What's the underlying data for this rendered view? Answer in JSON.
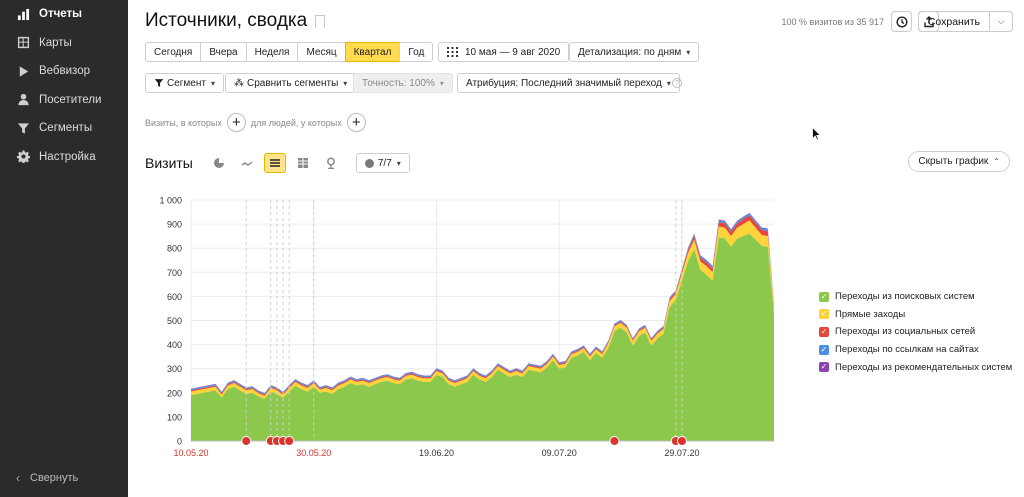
{
  "sidebar": {
    "items": [
      {
        "label": "Отчеты",
        "icon": "bar-chart-icon",
        "active": true
      },
      {
        "label": "Карты",
        "icon": "map-icon",
        "active": false
      },
      {
        "label": "Вебвизор",
        "icon": "play-icon",
        "active": false
      },
      {
        "label": "Посетители",
        "icon": "person-icon",
        "active": false
      },
      {
        "label": "Сегменты",
        "icon": "funnel-icon",
        "active": false
      },
      {
        "label": "Настройка",
        "icon": "gear-icon",
        "active": false
      }
    ],
    "collapse_label": "Свернуть"
  },
  "header": {
    "title": "Источники, сводка",
    "visits_info": "100 % визитов из 35 917",
    "save_label": "Сохранить"
  },
  "period": {
    "options": [
      "Сегодня",
      "Вчера",
      "Неделя",
      "Месяц",
      "Квартал",
      "Год"
    ],
    "selected": "Квартал",
    "date_range": "10 мая — 9 авг 2020",
    "detail": "Детализация: по дням"
  },
  "filters": {
    "segment": "Сегмент",
    "compare": "Сравнить сегменты",
    "accuracy": "Точность: 100%",
    "attribution": "Атрибуция: Последний значимый переход"
  },
  "conditions": {
    "visits_label": "Визиты, в которых",
    "people_label": "для людей, у которых"
  },
  "chart_header": {
    "title": "Визиты",
    "series_count": "7/7",
    "hide_label": "Скрыть график"
  },
  "colors": {
    "search": "#8cc84b",
    "direct": "#ffd43b",
    "social": "#e8453c",
    "links": "#4a90e2",
    "recommend": "#8e44ad",
    "accent": "#ffdb4d",
    "sidebar": "#2b2b2b"
  },
  "chart_data": {
    "type": "area",
    "stacked": true,
    "ylim": [
      0,
      1000
    ],
    "yticks": [
      "0",
      "100",
      "200",
      "300",
      "400",
      "500",
      "600",
      "700",
      "800",
      "900",
      "1 000"
    ],
    "xticks": [
      {
        "label": "10.05.20",
        "index": 0,
        "holiday": true
      },
      {
        "label": "30.05.20",
        "index": 20,
        "holiday": true
      },
      {
        "label": "19.06.20",
        "index": 40,
        "holiday": false
      },
      {
        "label": "09.07.20",
        "index": 60,
        "holiday": false
      },
      {
        "label": "29.07.20",
        "index": 80,
        "holiday": false
      }
    ],
    "markers_x": [
      9,
      13,
      14,
      15,
      16,
      69,
      79,
      80
    ],
    "dashed_lines_x": [
      9,
      13,
      14,
      15,
      16,
      20,
      79,
      80
    ],
    "series": [
      {
        "name": "Переходы из поисковых систем",
        "color_key": "search",
        "values": [
          190,
          195,
          200,
          205,
          210,
          180,
          215,
          225,
          210,
          195,
          200,
          185,
          175,
          205,
          195,
          180,
          205,
          230,
          215,
          205,
          225,
          200,
          205,
          195,
          215,
          225,
          240,
          230,
          235,
          225,
          235,
          245,
          250,
          240,
          235,
          255,
          260,
          250,
          245,
          245,
          275,
          265,
          235,
          225,
          235,
          245,
          275,
          255,
          245,
          265,
          295,
          280,
          265,
          275,
          265,
          295,
          290,
          285,
          305,
          335,
          300,
          305,
          345,
          355,
          370,
          335,
          365,
          345,
          385,
          455,
          470,
          450,
          395,
          435,
          450,
          395,
          425,
          445,
          555,
          585,
          665,
          745,
          795,
          710,
          690,
          665,
          845,
          840,
          805,
          840,
          850,
          860,
          835,
          810,
          805,
          525
        ]
      },
      {
        "name": "Прямые заходы",
        "color_key": "direct",
        "values": [
          15,
          15,
          15,
          15,
          15,
          12,
          15,
          15,
          15,
          15,
          15,
          12,
          12,
          15,
          15,
          12,
          15,
          15,
          15,
          15,
          15,
          12,
          15,
          15,
          15,
          15,
          15,
          15,
          15,
          15,
          15,
          15,
          15,
          15,
          15,
          15,
          15,
          15,
          15,
          15,
          15,
          15,
          15,
          15,
          15,
          15,
          15,
          15,
          15,
          15,
          15,
          15,
          15,
          15,
          15,
          15,
          15,
          15,
          15,
          15,
          15,
          15,
          15,
          15,
          15,
          15,
          15,
          15,
          20,
          20,
          20,
          20,
          20,
          20,
          20,
          20,
          20,
          20,
          25,
          25,
          30,
          35,
          40,
          35,
          35,
          35,
          45,
          45,
          45,
          45,
          50,
          55,
          50,
          45,
          45,
          25
        ]
      },
      {
        "name": "Переходы из социальных сетей",
        "color_key": "social",
        "values": [
          5,
          5,
          5,
          5,
          5,
          5,
          5,
          5,
          5,
          5,
          5,
          5,
          5,
          5,
          5,
          5,
          5,
          5,
          5,
          5,
          5,
          5,
          5,
          5,
          5,
          5,
          5,
          5,
          5,
          5,
          5,
          5,
          5,
          5,
          5,
          5,
          5,
          5,
          5,
          5,
          5,
          5,
          5,
          5,
          5,
          5,
          5,
          5,
          5,
          5,
          5,
          5,
          5,
          5,
          5,
          5,
          5,
          5,
          5,
          5,
          5,
          5,
          5,
          5,
          5,
          5,
          5,
          5,
          5,
          5,
          5,
          5,
          5,
          5,
          5,
          5,
          5,
          5,
          8,
          8,
          10,
          12,
          15,
          15,
          15,
          15,
          18,
          18,
          18,
          18,
          20,
          20,
          20,
          20,
          20,
          10
        ]
      },
      {
        "name": "Переходы по ссылкам на сайтах",
        "color_key": "links",
        "values": [
          5,
          5,
          5,
          5,
          5,
          5,
          5,
          5,
          5,
          5,
          5,
          5,
          5,
          5,
          5,
          5,
          5,
          5,
          5,
          5,
          5,
          5,
          5,
          5,
          5,
          5,
          5,
          5,
          5,
          5,
          5,
          5,
          5,
          5,
          5,
          5,
          5,
          5,
          5,
          5,
          5,
          5,
          5,
          5,
          5,
          5,
          5,
          5,
          5,
          5,
          5,
          5,
          5,
          5,
          5,
          5,
          5,
          5,
          5,
          5,
          5,
          5,
          5,
          5,
          5,
          5,
          5,
          5,
          5,
          5,
          5,
          5,
          5,
          5,
          5,
          5,
          5,
          5,
          5,
          5,
          5,
          8,
          8,
          8,
          8,
          8,
          8,
          8,
          8,
          8,
          8,
          8,
          8,
          8,
          8,
          5
        ]
      },
      {
        "name": "Переходы из рекомендательных систем",
        "color_key": "recommend",
        "values": [
          2,
          2,
          2,
          2,
          2,
          2,
          2,
          2,
          2,
          2,
          2,
          2,
          2,
          2,
          2,
          2,
          2,
          2,
          2,
          2,
          2,
          2,
          2,
          2,
          2,
          2,
          2,
          2,
          2,
          2,
          2,
          2,
          2,
          2,
          2,
          2,
          2,
          2,
          2,
          2,
          2,
          2,
          2,
          2,
          2,
          2,
          2,
          2,
          2,
          2,
          2,
          2,
          2,
          2,
          2,
          2,
          2,
          2,
          2,
          2,
          2,
          2,
          2,
          2,
          2,
          2,
          2,
          2,
          2,
          2,
          2,
          2,
          2,
          2,
          2,
          2,
          2,
          2,
          3,
          3,
          3,
          3,
          3,
          3,
          3,
          3,
          3,
          3,
          3,
          3,
          3,
          3,
          3,
          3,
          3,
          2
        ]
      }
    ]
  }
}
